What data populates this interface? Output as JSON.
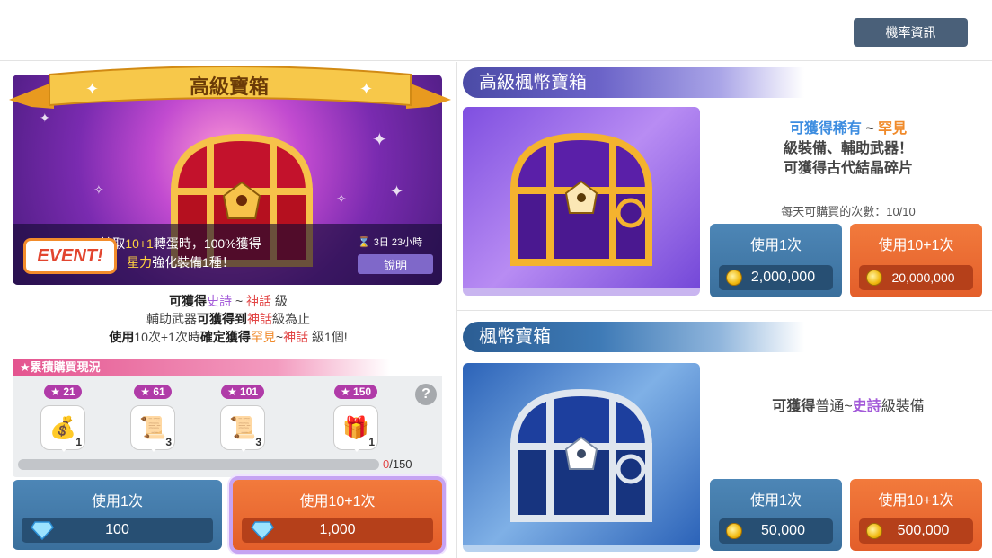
{
  "header": {
    "probability_button": "機率資訊"
  },
  "featured": {
    "title": "高級寶箱",
    "event_tag": "EVENT!",
    "info_line1_a": "抽取",
    "info_line1_b": "10+1",
    "info_line1_c": "轉蛋時，100%獲得",
    "info_line2_a": "星力",
    "info_line2_b": "強化裝備1種！",
    "timer": "3日 23小時",
    "explain_button": "說明",
    "desc1_a": "可獲得",
    "desc1_b": "史詩",
    "desc1_c": " ~ ",
    "desc1_d": "神話",
    "desc1_e": " 級",
    "desc2_a": "輔助武器",
    "desc2_b": "可獲得到",
    "desc2_c": "神話",
    "desc2_d": "級為止",
    "desc3_a": "使用",
    "desc3_b": "10次+1次時",
    "desc3_c": "確定獲得",
    "desc3_d": "罕見",
    "desc3_e": "~",
    "desc3_f": "神話",
    "desc3_g": " 級1個!"
  },
  "cumulative": {
    "header": "★累積購買現況",
    "milestones": [
      {
        "badge": "★ 21",
        "count": "1"
      },
      {
        "badge": "★ 61",
        "count": "3"
      },
      {
        "badge": "★ 101",
        "count": "3"
      },
      {
        "badge": "★ 150",
        "count": "1"
      }
    ],
    "help": "?",
    "progress_current": "0",
    "progress_total": "/150",
    "progress_fraction": 0
  },
  "featured_buttons": {
    "single_label": "使用1次",
    "single_price": "100",
    "multi_label": "使用10+1次",
    "multi_price": "1,000"
  },
  "premium_maple": {
    "title": "高級楓幣寶箱",
    "line1_a": "可獲得稀有",
    "line1_b": " ~ ",
    "line1_c": "罕見",
    "line2": "級裝備、輔助武器！",
    "line3": "可獲得古代結晶碎片",
    "daily_limit": "每天可購買的次數：10/10",
    "single_label": "使用1次",
    "single_price": "2,000,000",
    "multi_label": "使用10+1次",
    "multi_price": "20,000,000"
  },
  "maple": {
    "title": "楓幣寶箱",
    "line_a": "可獲得",
    "line_b": "普通~",
    "line_c": "史詩",
    "line_d": "級裝備",
    "single_label": "使用1次",
    "single_price": "50,000",
    "multi_label": "使用10+1次",
    "multi_price": "500,000"
  },
  "colors": {
    "blue_button": "#3a6f9c",
    "orange_button": "#e35e2a",
    "epic_purple": "#a35ad9",
    "mythic_red": "#e24545",
    "unique_orange": "#f08a2a"
  }
}
